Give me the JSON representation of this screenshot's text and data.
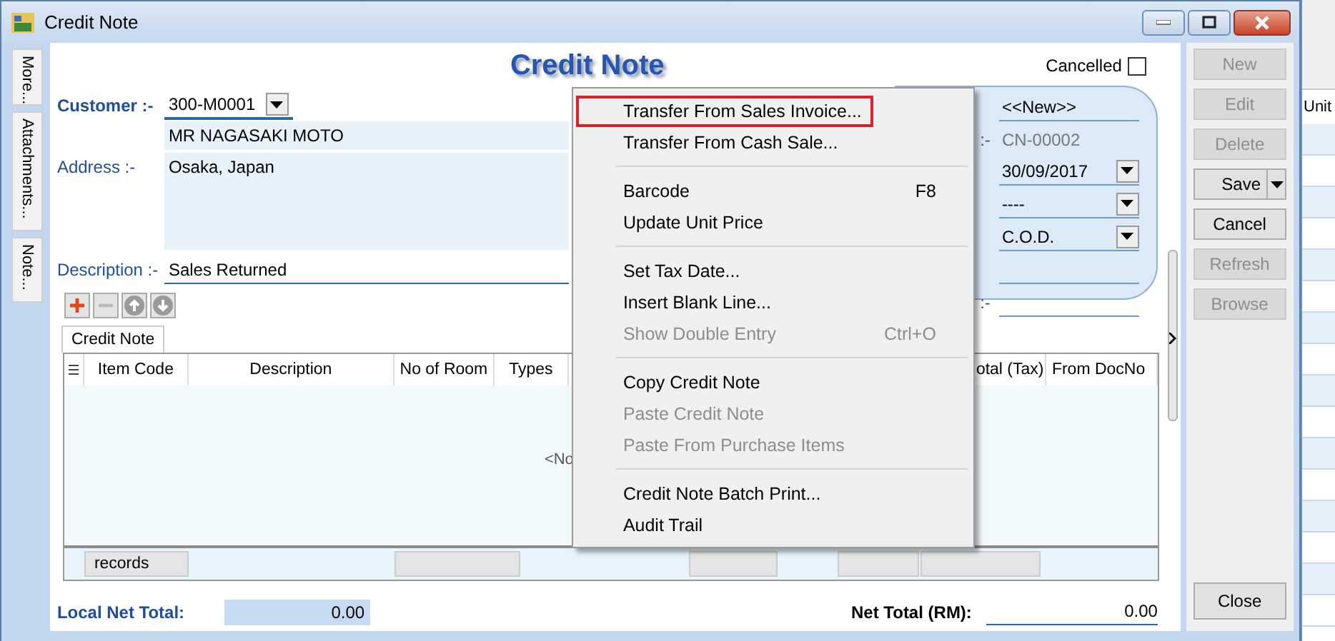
{
  "window": {
    "title": "Credit Note"
  },
  "side_tabs": [
    {
      "label": "More..."
    },
    {
      "label": "Attachments..."
    },
    {
      "label": "Note..."
    }
  ],
  "form": {
    "heading": "Credit Note",
    "cancelled": {
      "label": "Cancelled",
      "checked": false
    },
    "customer": {
      "label": "Customer :-",
      "value": "300-M0001"
    },
    "name": {
      "value": "MR NAGASAKI MOTO"
    },
    "address": {
      "label": "Address :-",
      "value": "Osaka, Japan"
    },
    "description": {
      "label": "Description :-",
      "value": "Sales Returned"
    }
  },
  "header_panel": {
    "fields": [
      {
        "value": "<<New>>",
        "dropdown": false,
        "disabled": false
      },
      {
        "label": ":-",
        "value": "CN-00002",
        "dropdown": false,
        "disabled": true
      },
      {
        "value": "30/09/2017",
        "dropdown": true,
        "disabled": false
      },
      {
        "value": "----",
        "dropdown": true,
        "disabled": false
      },
      {
        "value": "C.O.D.",
        "dropdown": true,
        "disabled": false
      },
      {
        "dropdown": false,
        "disabled": false
      },
      {
        "label": ":-",
        "dropdown": false,
        "disabled": false
      }
    ]
  },
  "tabs": [
    {
      "label": "Credit Note",
      "selected": true
    }
  ],
  "grid": {
    "columns": [
      {
        "label": "Item Code"
      },
      {
        "label": "Description"
      },
      {
        "label": "No of Room"
      },
      {
        "label": "Types"
      },
      {
        "label": "otal (Tax)"
      },
      {
        "label": "From DocNo"
      }
    ],
    "empty_text": "<No",
    "footer": "records"
  },
  "totals": {
    "local": {
      "label": "Local Net Total:",
      "value": "0.00"
    },
    "net": {
      "label": "Net Total (RM):",
      "value": "0.00"
    }
  },
  "buttons": [
    {
      "label": "New",
      "kind": "plain",
      "disabled": true
    },
    {
      "label": "Edit",
      "kind": "plain",
      "disabled": true
    },
    {
      "label": "Delete",
      "kind": "plain",
      "disabled": true
    },
    {
      "label": "Save",
      "kind": "split",
      "disabled": false
    },
    {
      "label": "Cancel",
      "kind": "plain",
      "disabled": false
    },
    {
      "label": "Refresh",
      "kind": "plain",
      "disabled": true
    },
    {
      "label": "Browse",
      "kind": "plain",
      "disabled": true
    }
  ],
  "close_button": {
    "label": "Close"
  },
  "menu": {
    "items": [
      {
        "kind": "item",
        "label": "Transfer From Sales Invoice...",
        "disabled": false,
        "boxed": true
      },
      {
        "kind": "item",
        "label": "Transfer From Cash Sale...",
        "disabled": false,
        "boxed": false
      },
      {
        "kind": "separator"
      },
      {
        "kind": "item",
        "label": "Barcode",
        "shortcut": "F8",
        "disabled": false,
        "boxed": false
      },
      {
        "kind": "item",
        "label": "Update Unit Price",
        "disabled": false,
        "boxed": false
      },
      {
        "kind": "separator"
      },
      {
        "kind": "item",
        "label": "Set Tax Date...",
        "disabled": false,
        "boxed": false
      },
      {
        "kind": "item",
        "label": "Insert Blank Line...",
        "disabled": false,
        "boxed": false
      },
      {
        "kind": "item",
        "label": "Show Double Entry",
        "shortcut": "Ctrl+O",
        "disabled": true,
        "boxed": false
      },
      {
        "kind": "separator"
      },
      {
        "kind": "item",
        "label": "Copy Credit Note",
        "disabled": false,
        "boxed": false
      },
      {
        "kind": "item",
        "label": "Paste Credit Note",
        "disabled": true,
        "boxed": false
      },
      {
        "kind": "item",
        "label": "Paste From Purchase Items",
        "disabled": true,
        "boxed": false
      },
      {
        "kind": "separator"
      },
      {
        "kind": "item",
        "label": "Credit Note Batch Print...",
        "disabled": false,
        "boxed": false
      },
      {
        "kind": "item",
        "label": "Audit Trail",
        "disabled": false,
        "boxed": false
      }
    ]
  },
  "background_app": {
    "column": "Unit"
  }
}
